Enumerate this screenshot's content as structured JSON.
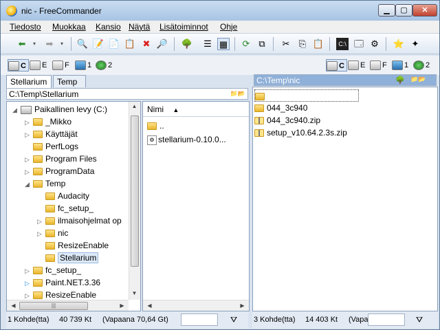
{
  "window": {
    "title": "nic - FreeCommander"
  },
  "menu": [
    "Tiedosto",
    "Muokkaa",
    "Kansio",
    "Näytä",
    "Lisätoiminnot",
    "Ohje"
  ],
  "drives": {
    "c": "C",
    "e": "E",
    "f": "F",
    "net1": "1",
    "ftp2": "2"
  },
  "left": {
    "tabs": [
      "Stellarium",
      "Temp"
    ],
    "path": "C:\\Temp\\Stellarium",
    "tree": [
      {
        "label": "Paikallinen levy (C:)",
        "level": 0,
        "expander": "◢"
      },
      {
        "label": "_Mikko",
        "level": 1,
        "expander": "▷"
      },
      {
        "label": "Käyttäjät",
        "level": 1,
        "expander": "▷"
      },
      {
        "label": "PerfLogs",
        "level": 1,
        "expander": ""
      },
      {
        "label": "Program Files",
        "level": 1,
        "expander": "▷"
      },
      {
        "label": "ProgramData",
        "level": 1,
        "expander": "▷"
      },
      {
        "label": "Temp",
        "level": 1,
        "expander": "◢"
      },
      {
        "label": "Audacity",
        "level": 2,
        "expander": ""
      },
      {
        "label": "fc_setup_",
        "level": 2,
        "expander": ""
      },
      {
        "label": "ilmaisohjelmat op",
        "level": 2,
        "expander": "▷"
      },
      {
        "label": "nic",
        "level": 2,
        "expander": "▷"
      },
      {
        "label": "ResizeEnable",
        "level": 2,
        "expander": ""
      },
      {
        "label": "Stellarium",
        "level": 2,
        "expander": "",
        "selected": true
      },
      {
        "label": "fc_setup_",
        "level": 1,
        "expander": "▷"
      },
      {
        "label": "Paint.NET.3.36",
        "level": 1,
        "expander": "▷",
        "blue": true
      },
      {
        "label": "ResizeEnable",
        "level": 1,
        "expander": "▷"
      }
    ],
    "list_header": "Nimi",
    "list": [
      {
        "name": "..",
        "type": "folder"
      },
      {
        "name": "stellarium-0.10.0...",
        "type": "file"
      }
    ],
    "status": {
      "count": "1 Kohde(tta)",
      "size": "40 739 Kt",
      "free": "(Vapaana 70,64 Gt)"
    }
  },
  "right": {
    "path": "C:\\Temp\\nic",
    "list": [
      {
        "name": "",
        "type": "folder"
      },
      {
        "name": "044_3c940",
        "type": "folder"
      },
      {
        "name": "044_3c940.zip",
        "type": "zip"
      },
      {
        "name": "setup_v10.64.2.3s.zip",
        "type": "zip"
      }
    ],
    "status": {
      "count": "3 Kohde(tta)",
      "size": "14 403 Kt",
      "free": "(Vapa"
    }
  }
}
